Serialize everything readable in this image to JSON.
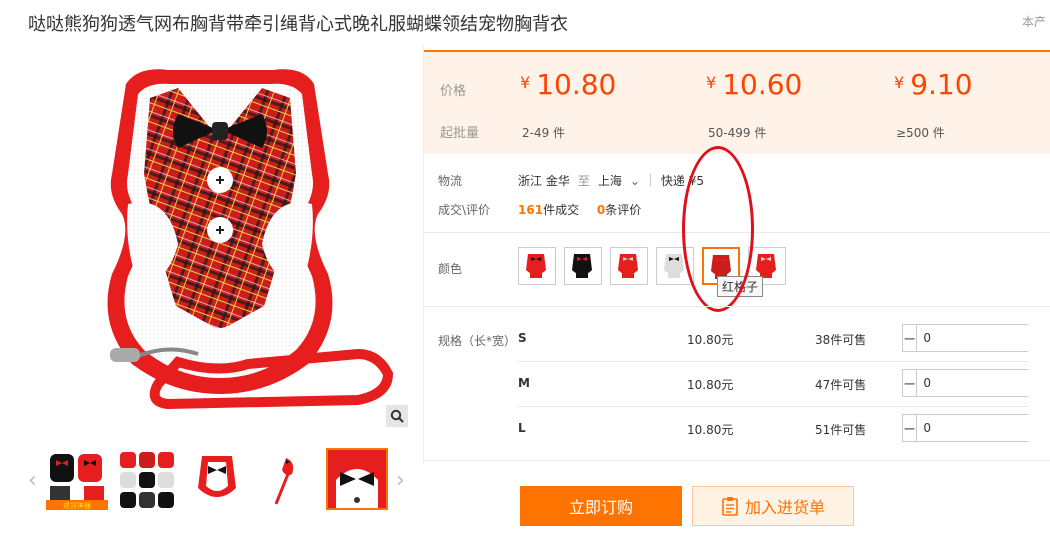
{
  "page": {
    "title": "哒哒熊狗狗透气网布胸背带牵引绳背心式晚礼服蝴蝶领结宠物胸背衣",
    "title_right": "本产"
  },
  "price_box": {
    "price_label": "价格",
    "moq_label": "起批量",
    "tiers": [
      {
        "currency": "¥",
        "price": "10.80",
        "range": "2-49 件"
      },
      {
        "currency": "¥",
        "price": "10.60",
        "range": "50-499 件"
      },
      {
        "currency": "¥",
        "price": "9.10",
        "range": "≥500 件"
      }
    ],
    "accent_color": "#ff4400",
    "background_color": "#fff2e8"
  },
  "logistics": {
    "label": "物流",
    "from": "浙江 金华",
    "to_word": "至",
    "to": "上海",
    "express": "快递 ¥5"
  },
  "deals": {
    "label": "成交\\评价",
    "count": "161",
    "count_suffix": "件成交",
    "reviews": "0",
    "reviews_suffix": "条评价"
  },
  "color": {
    "label": "颜色",
    "tooltip": "红格子",
    "selected_index": 4,
    "swatches": [
      "swatch-1",
      "swatch-2",
      "swatch-3",
      "swatch-4",
      "swatch-5",
      "swatch-6"
    ]
  },
  "spec": {
    "label": "规格（长*宽）",
    "rows": [
      {
        "name": "S",
        "price": "10.80元",
        "stock": "38件可售",
        "qty": "0"
      },
      {
        "name": "M",
        "price": "10.80元",
        "stock": "47件可售",
        "qty": "0"
      },
      {
        "name": "L",
        "price": "10.80元",
        "stock": "51件可售",
        "qty": "0"
      }
    ]
  },
  "actions": {
    "order": "立即订购",
    "cart": "加入进货单"
  },
  "thumbnail_badge": "退货神器",
  "icons": [
    "zoom-icon",
    "chevron-left-icon",
    "chevron-right-icon",
    "chevron-down-icon",
    "clipboard-icon",
    "minus-icon",
    "plus-icon"
  ]
}
